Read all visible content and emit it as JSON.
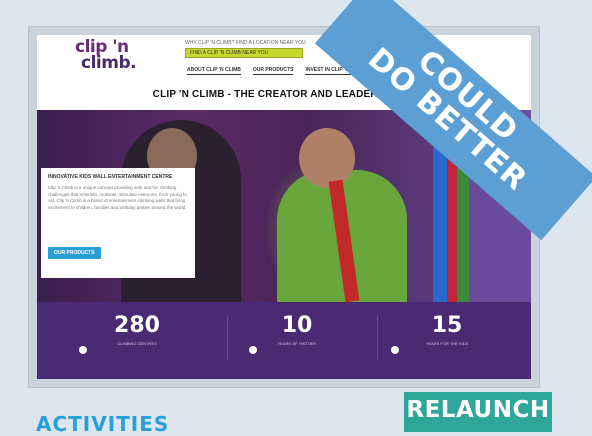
{
  "site": {
    "logo_line1": "clip 'n",
    "logo_line2": "climb.",
    "topline": "WHY CLIP 'N CLIMB? FIND A LOCATION NEAR YOU",
    "search_placeholder": "FIND A CLIP 'N CLIMB NEAR YOU",
    "nav": [
      "ABOUT CLIP 'N CLIMB",
      "OUR PRODUCTS",
      "INVEST IN CLIP 'N CLIMB"
    ],
    "headline": "CLIP 'N CLIMB - THE CREATOR AND LEADER IN FUN",
    "card": {
      "title": "INNOVATIVE KIDS WALL ENTERTAINMENT CENTRE",
      "body": "Clip 'n Climb is a unique concept providing safe and fun climbing challenges that entertain, motivate, stimulate everyone, from young to old. Clip 'n Climb is a brand of entertainment climbing walls that bring excitement to children, families and birthday parties around the world.",
      "button": "OUR PRODUCTS"
    },
    "stats": [
      {
        "value": "280",
        "label": "CLIMBING CENTRES"
      },
      {
        "value": "10",
        "label": "YEARS OF HISTORY"
      },
      {
        "value": "15",
        "label": "YEARS FOR THE KIDS"
      }
    ]
  },
  "ribbon": {
    "line1": "COULD",
    "line2": "DO BETTER"
  },
  "badge": "RELAUNCH",
  "section_heading": "ACTIVITIES",
  "colors": {
    "ribbon": "#5b9fd4",
    "badge": "#2fa69a",
    "heading": "#27a0d8",
    "stats_bg": "#4a2a72",
    "search": "#c8d62e"
  }
}
